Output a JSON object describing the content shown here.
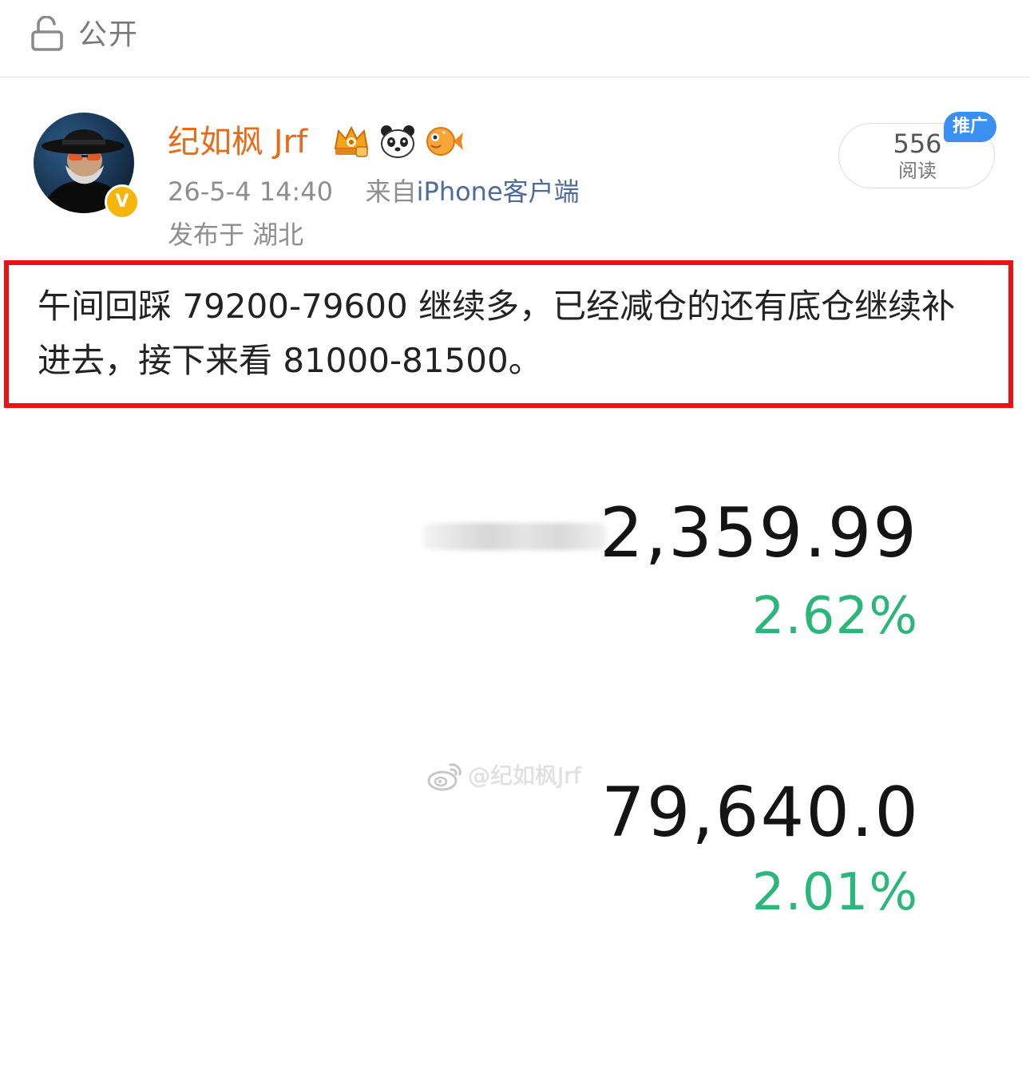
{
  "topbar": {
    "visibility_icon": "unlock-icon",
    "visibility_label": "公开"
  },
  "post": {
    "author": {
      "name": "纪如枫 Jrf",
      "avatar_icon": "avatar-image",
      "verified_icon": "verified-v-icon",
      "verified_text": "V",
      "badges": [
        "crown-badge-icon",
        "panda-badge-icon",
        "pufferfish-badge-icon"
      ],
      "name_color": "#e86b1a"
    },
    "timestamp": "26-5-4 14:40",
    "source_prefix": "来自",
    "source": "iPhone客户端",
    "location": "发布于 湖北",
    "reads": {
      "count": "556",
      "label": "阅读",
      "promo_tag": "推广"
    },
    "text": "午间回踩 79200-79600 继续多，已经减仓的还有底仓继续补进去，接下来看 81000-81500。",
    "highlight_color": "#ee1111"
  },
  "image": {
    "ticker_1": {
      "price": "2,359.99",
      "change": "2.62%"
    },
    "ticker_2": {
      "price": "79,640.0",
      "change": "2.01%"
    },
    "watermark": "@纪如枫Jrf",
    "watermark_icon": "weibo-logo-icon",
    "positive_color": "#2db67c"
  }
}
